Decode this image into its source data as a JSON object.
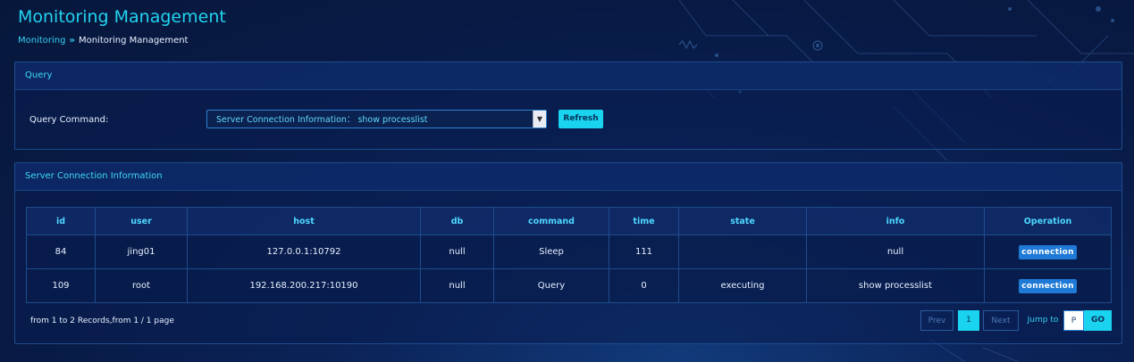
{
  "page": {
    "title": "Monitoring Management",
    "breadcrumb": {
      "parent": "Monitoring",
      "separator": "»",
      "current": "Monitoring Management"
    }
  },
  "query_panel": {
    "heading": "Query",
    "command_label": "Query Command:",
    "command_value": "Server Connection Information： show processlist",
    "refresh_label": "Refresh"
  },
  "info_panel": {
    "heading": "Server Connection Information",
    "columns": [
      "id",
      "user",
      "host",
      "db",
      "command",
      "time",
      "state",
      "info",
      "Operation"
    ],
    "rows": [
      {
        "id": "84",
        "user": "jing01",
        "host": "127.0.0.1:10792",
        "db": "null",
        "command": "Sleep",
        "time": "111",
        "state": "",
        "info": "null",
        "operation": "connection"
      },
      {
        "id": "109",
        "user": "root",
        "host": "192.168.200.217:10190",
        "db": "null",
        "command": "Query",
        "time": "0",
        "state": "executing",
        "info": "show processlist",
        "operation": "connection"
      }
    ],
    "summary": "from 1 to 2 Records,from 1 / 1 page",
    "pagination": {
      "prev": "Prev",
      "current_page": "1",
      "next": "Next",
      "jump_label": "Jump to",
      "page_placeholder": "P",
      "go": "GO"
    }
  },
  "colors": {
    "accent": "#19d3ef",
    "button": "#1f79d6",
    "background": "#081a44"
  }
}
